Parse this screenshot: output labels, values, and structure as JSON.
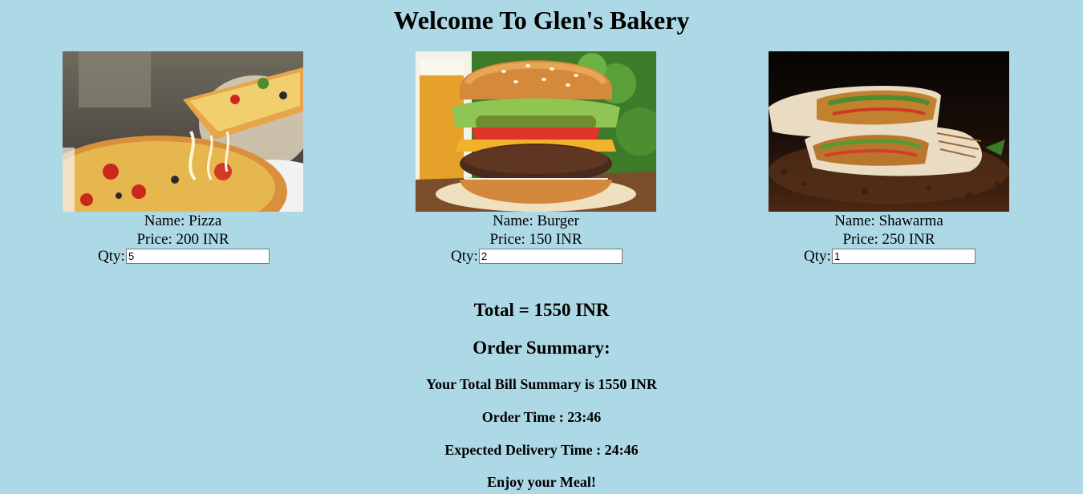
{
  "header": {
    "title": "Welcome To Glen's Bakery"
  },
  "products": [
    {
      "image_icon": "pizza-image",
      "name_label": "Name:",
      "name": "Pizza",
      "price_label": "Price:",
      "price": "200 INR",
      "qty_label": "Qty:",
      "qty": "5"
    },
    {
      "image_icon": "burger-image",
      "name_label": "Name:",
      "name": "Burger",
      "price_label": "Price:",
      "price": "150 INR",
      "qty_label": "Qty:",
      "qty": "2"
    },
    {
      "image_icon": "shawarma-image",
      "name_label": "Name:",
      "name": "Shawarma",
      "price_label": "Price:",
      "price": "250 INR",
      "qty_label": "Qty:",
      "qty": "1"
    }
  ],
  "total": {
    "text": "Total = 1550 INR"
  },
  "summary": {
    "heading": "Order Summary:",
    "bill": "Your Total Bill Summary is 1550 INR",
    "order_time": "Order Time : 23:46",
    "delivery_time": "Expected Delivery Time : 24:46",
    "closing": "Enjoy your Meal!"
  },
  "colors": {
    "background": "#ADD8E6"
  }
}
